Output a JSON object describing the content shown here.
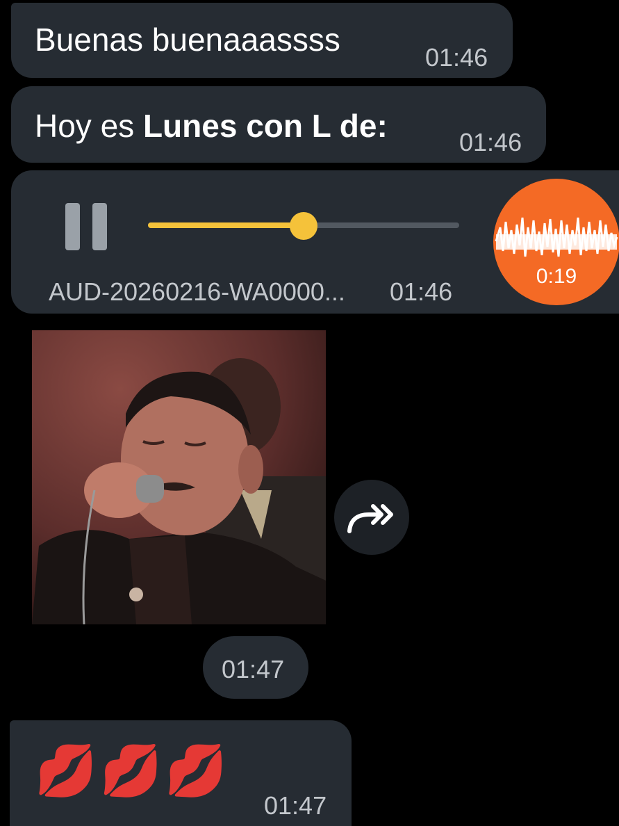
{
  "messages": [
    {
      "text": "Buenas buenaaassss",
      "time": "01:46"
    },
    {
      "text_plain": "Hoy es ",
      "text_bold": "Lunes con L de:",
      "time": "01:46"
    }
  ],
  "audio": {
    "filename": "AUD-20260216-WA0000...",
    "time": "01:46",
    "duration": "0:19",
    "progress": 0.5,
    "state": "playing",
    "accent_color": "#f5c23a",
    "avatar_color": "#f46a25"
  },
  "media": {
    "time": "01:47",
    "forward_icon": "forward-icon"
  },
  "emoji_message": {
    "emojis": [
      "💋",
      "💋",
      "💋"
    ],
    "time": "01:47"
  },
  "colors": {
    "background": "#000000",
    "bubble": "#262c33",
    "time_text": "#c3c7cc"
  }
}
